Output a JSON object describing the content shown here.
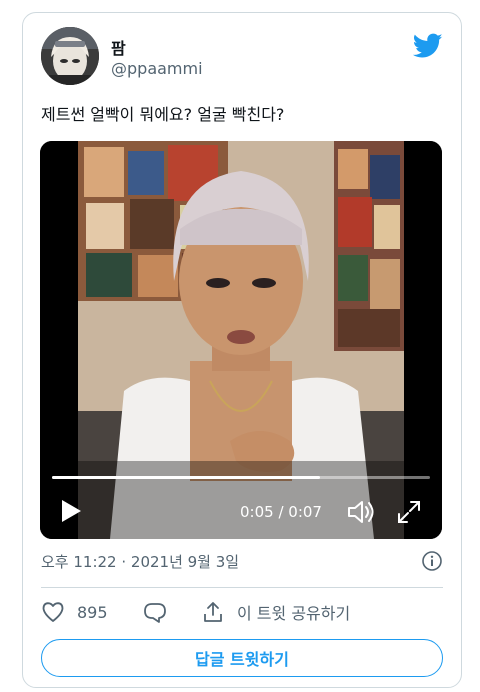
{
  "user": {
    "display_name": "팜",
    "handle": "@ppaammi"
  },
  "brand_icon": "twitter-bird-icon",
  "tweet": {
    "text": "제트썬 얼빡이 뭐에요? 얼굴 빡친다?"
  },
  "video": {
    "time": "0:05 / 0:07",
    "progress": 0.71,
    "controls": [
      "play-icon",
      "volume-icon",
      "fullscreen-icon"
    ]
  },
  "meta": {
    "timestamp": "오후 11:22 · 2021년 9월 3일"
  },
  "actions": {
    "likes": "895",
    "share_label": "이 트윗 공유하기"
  },
  "reply_button": "답글 트윗하기",
  "colors": {
    "accent": "#1d9bf0",
    "secondary_text": "#536471",
    "border": "#cfd9de"
  }
}
